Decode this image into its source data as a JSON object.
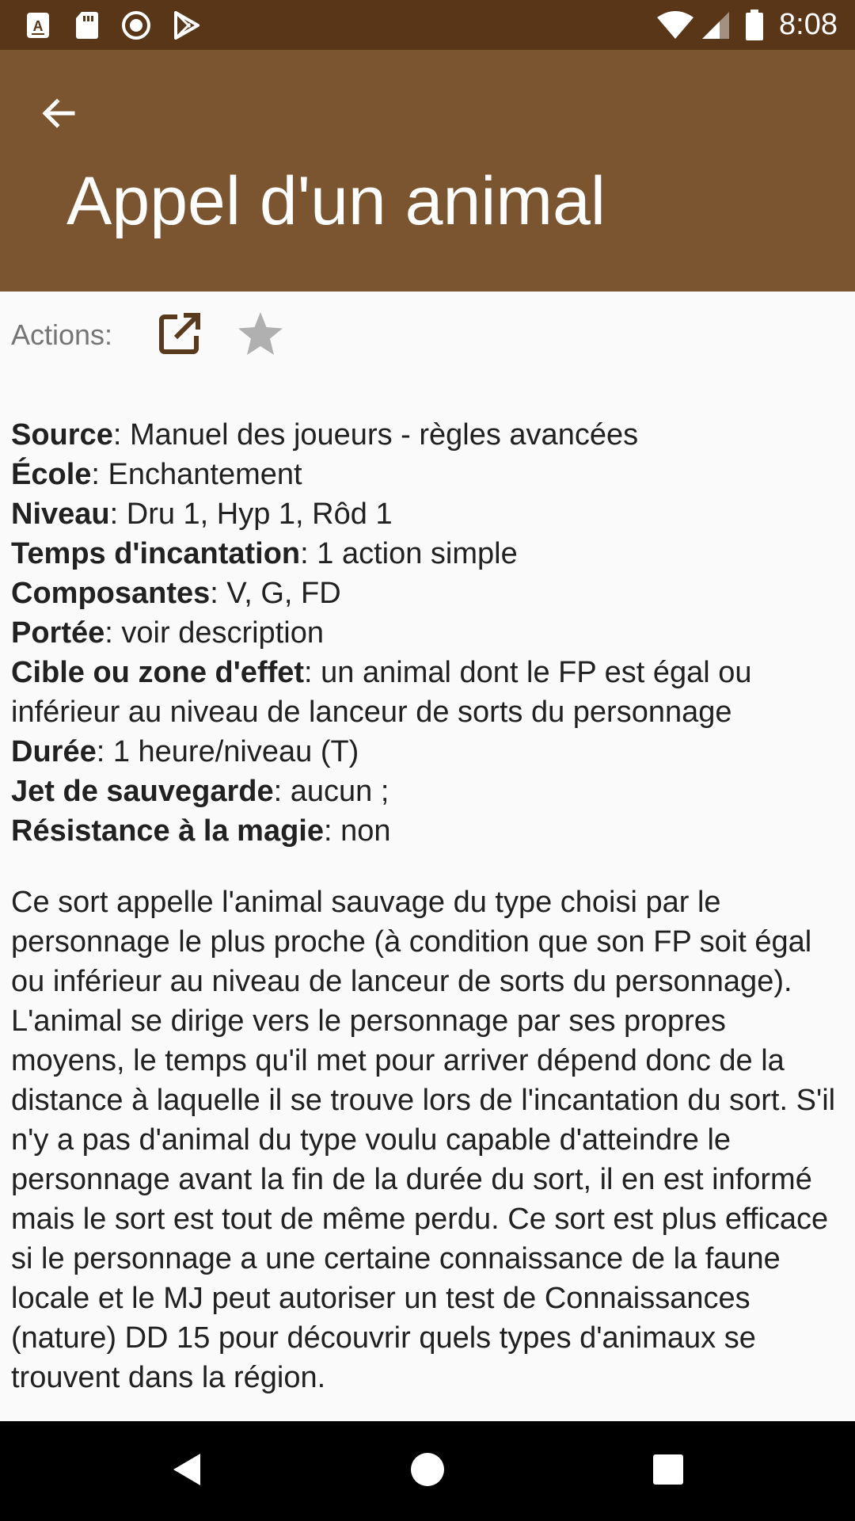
{
  "status_bar": {
    "time": "8:08",
    "icons": [
      "app-notification-icon",
      "sd-card-icon",
      "record-icon",
      "play-store-icon",
      "wifi-icon",
      "signal-icon",
      "battery-icon"
    ]
  },
  "app_bar": {
    "back_icon": "arrow-back-icon",
    "title": "Appel d'un animal",
    "color": "#7b5430",
    "status_color": "#583617"
  },
  "actions": {
    "label": "Actions:",
    "open_icon": "open-external-icon",
    "favorite_icon": "star-icon"
  },
  "properties": [
    {
      "key": "Source",
      "sep": ": ",
      "value": "Manuel des joueurs - règles avancées"
    },
    {
      "key": "École",
      "sep": ": ",
      "value": "Enchantement"
    },
    {
      "key": "Niveau",
      "sep": ": ",
      "value": "Dru 1, Hyp 1, Rôd 1"
    },
    {
      "key": "Temps d'incantation",
      "sep": ": ",
      "value": "1 action simple"
    },
    {
      "key": "Composantes",
      "sep": ": ",
      "value": "V, G, FD"
    },
    {
      "key": "Portée",
      "sep": ": ",
      "value": "voir description"
    },
    {
      "key": "Cible ou zone d'effet",
      "sep": ": ",
      "value": "un animal dont le FP est égal ou inférieur au niveau de lanceur de sorts du personnage"
    },
    {
      "key": "Durée",
      "sep": ": ",
      "value": "1 heure/niveau (T)"
    },
    {
      "key": "Jet de sauvegarde",
      "sep": ": ",
      "value": "aucun ;"
    },
    {
      "key": "Résistance à la magie",
      "sep": ": ",
      "value": "non"
    }
  ],
  "description": "Ce sort appelle l'animal sauvage du type choisi par le personnage le plus proche (à condition que son FP soit égal ou inférieur au niveau de lanceur de sorts du personnage). L'animal se dirige vers le personnage par ses propres moyens, le temps qu'il met pour arriver dépend donc de la distance à laquelle il se trouve lors de l'incantation du sort. S'il n'y a pas d'animal du type voulu capable d'atteindre le personnage avant la fin de la durée du sort, il en est informé mais le sort est tout de même perdu. Ce sort est plus efficace si le personnage a une certaine connaissance de la faune locale et le MJ peut autoriser un test de Connaissances (nature) DD 15 pour découvrir quels types d'animaux se trouvent dans la région.",
  "nav_bar": {
    "icons": [
      "back-triangle-icon",
      "home-circle-icon",
      "recents-square-icon"
    ]
  }
}
